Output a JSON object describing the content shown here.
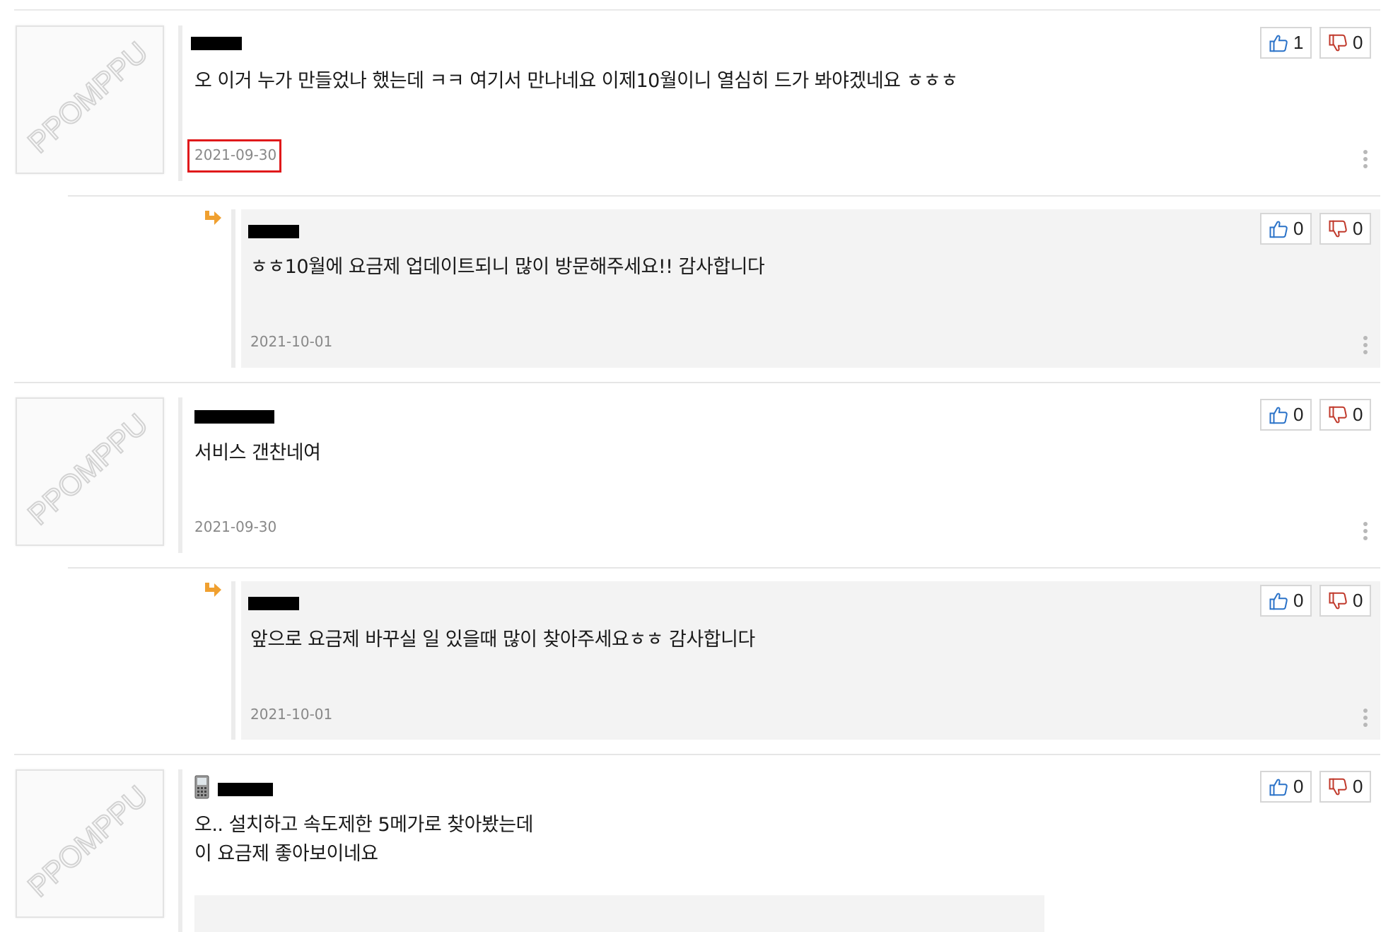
{
  "comments": [
    {
      "text": "오 이거 누가 만들었나 했는데 ㅋㅋ 여기서 만나네요 이제10월이니 열심히 드가 봐야겠네요 ㅎㅎㅎ",
      "date": "2021-09-30",
      "up": "1",
      "down": "0",
      "highlighted": true,
      "reply": {
        "text": "ㅎㅎ10월에 요금제 업데이트되니 많이 방문해주세요!! 감사합니다",
        "date": "2021-10-01",
        "up": "0",
        "down": "0"
      }
    },
    {
      "text": "서비스 갠찬네여",
      "date": "2021-09-30",
      "up": "0",
      "down": "0",
      "reply": {
        "text": "앞으로 요금제 바꾸실 일 있을때 많이 찾아주세요ㅎㅎ 감사합니다",
        "date": "2021-10-01",
        "up": "0",
        "down": "0"
      }
    },
    {
      "text_lines": [
        "오..  설치하고 속도제한 5메가로 찾아봤는데",
        "이 요금제 좋아보이네요"
      ],
      "up": "0",
      "down": "0",
      "device_icon": "mobile-phone-icon"
    }
  ],
  "avatar_watermark": "PPOMPPU",
  "colors": {
    "highlight": "#e0191b",
    "reply_arrow": "#f0a030",
    "thumb_up": "#2a72c8",
    "thumb_down": "#c0392b"
  }
}
